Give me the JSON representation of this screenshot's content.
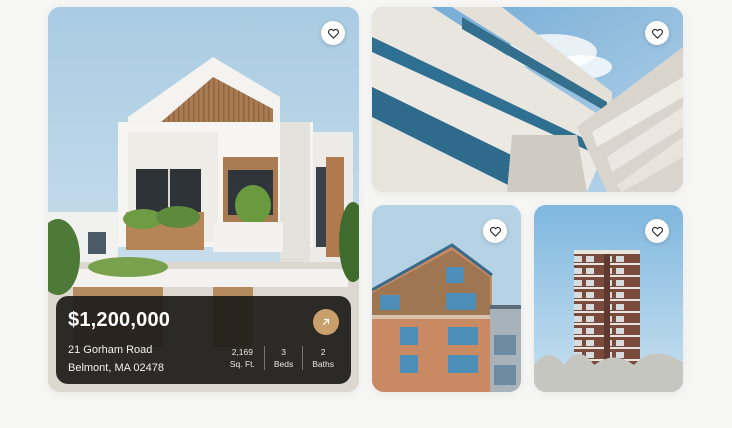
{
  "listing": {
    "price": "$1,200,000",
    "address_line1": "21 Gorham Road",
    "address_line2": "Belmont, MA 02478",
    "stats": [
      {
        "value": "2,169",
        "label": "Sq. Ft."
      },
      {
        "value": "3",
        "label": "Beds"
      },
      {
        "value": "2",
        "label": "Baths"
      }
    ]
  },
  "icons": {
    "favorite": "heart-outline-icon",
    "open": "arrow-up-right-icon"
  },
  "colors": {
    "page_background": "#f6f6f5",
    "overlay": "#1e1c1a",
    "accent": "#c9a06b",
    "sky": "#b8d4e6"
  }
}
